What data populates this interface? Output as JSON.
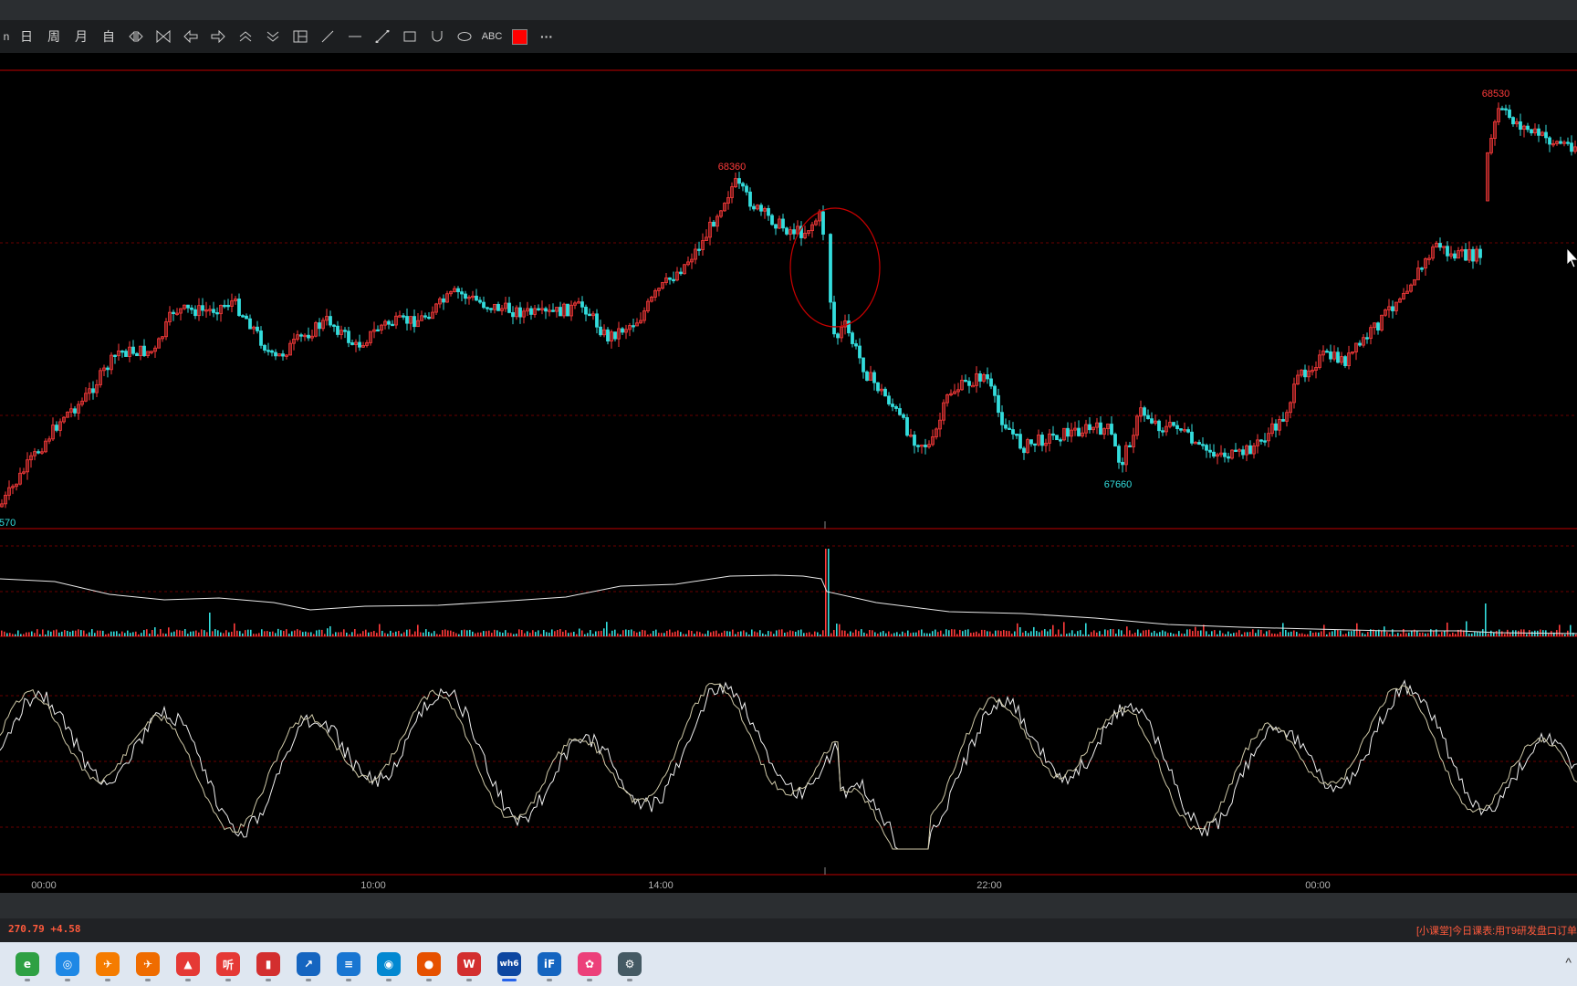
{
  "toolbar": {
    "items": [
      {
        "label": "日",
        "name": "period-day-button"
      },
      {
        "label": "周",
        "name": "period-week-button"
      },
      {
        "label": "月",
        "name": "period-month-button"
      },
      {
        "label": "自",
        "name": "period-custom-button"
      }
    ],
    "text_tool_label": "ABC",
    "more_label": "···",
    "color_swatch": "#ff0000"
  },
  "chart": {
    "price_labels": {
      "high_mid": "68360",
      "high_right": "68530",
      "low": "67660",
      "left_edge": "570"
    },
    "time_labels": [
      "00:00",
      "10:00",
      "14:00",
      "22:00",
      "00:00"
    ],
    "colors": {
      "up": "#ff3b3b",
      "down": "#33dddd",
      "grid": "#aa0000",
      "indicator": "#e8e8e8",
      "annotation": "#cc0000"
    }
  },
  "chart_data": {
    "type": "candlestick",
    "panels": [
      "price",
      "volume",
      "oscillator"
    ],
    "price_markers": [
      {
        "label": "68360",
        "time": "15:10"
      },
      {
        "label": "67660",
        "time": "22:00"
      },
      {
        "label": "68530",
        "time": "01:00"
      }
    ],
    "x_ticks": [
      "00:00",
      "10:00",
      "14:00",
      "22:00",
      "00:00"
    ],
    "annotation": "ellipse around sharp drop near 17:00"
  },
  "status": {
    "left": "270.79  +4.58",
    "right": "[小课堂]今日课表:用T9研发盘口订单"
  },
  "taskbar": {
    "apps": [
      {
        "name": "app-browser-green-icon",
        "color": "#2ea043",
        "glyph": "e"
      },
      {
        "name": "app-browser-blue-icon",
        "color": "#1e88e5",
        "glyph": "◎"
      },
      {
        "name": "app-orange-1-icon",
        "color": "#f57c00",
        "glyph": "✈"
      },
      {
        "name": "app-orange-2-icon",
        "color": "#ef6c00",
        "glyph": "✈"
      },
      {
        "name": "app-red-chart-icon",
        "color": "#e53935",
        "glyph": "▲"
      },
      {
        "name": "app-ting-icon",
        "color": "#e53935",
        "glyph": "听"
      },
      {
        "name": "app-stock-red-icon",
        "color": "#d32f2f",
        "glyph": "▮"
      },
      {
        "name": "app-chart-blue-icon",
        "color": "#1565c0",
        "glyph": "↗"
      },
      {
        "name": "app-notepad-icon",
        "color": "#1976d2",
        "glyph": "≡"
      },
      {
        "name": "app-browser-cloud-icon",
        "color": "#0288d1",
        "glyph": "◉"
      },
      {
        "name": "app-game-icon",
        "color": "#e65100",
        "glyph": "●"
      },
      {
        "name": "app-wps-icon",
        "color": "#d32f2f",
        "glyph": "W"
      },
      {
        "name": "app-wh6-icon",
        "color": "#0d47a1",
        "glyph": "wh6",
        "active": true
      },
      {
        "name": "app-ifly-icon",
        "color": "#1565c0",
        "glyph": "iF"
      },
      {
        "name": "app-pink-icon",
        "color": "#ec407a",
        "glyph": "✿"
      },
      {
        "name": "app-settings-icon",
        "color": "#455a64",
        "glyph": "⚙"
      }
    ]
  }
}
